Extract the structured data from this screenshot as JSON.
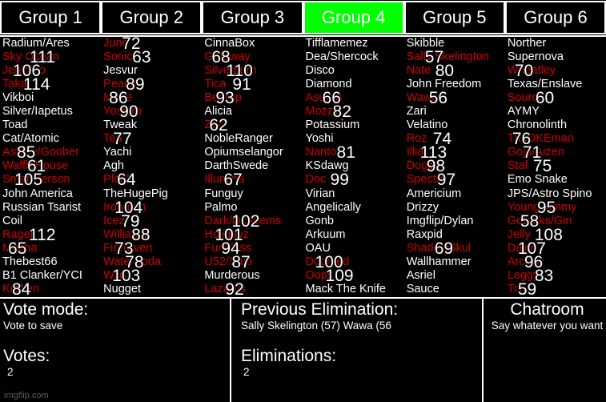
{
  "tabs": [
    {
      "label": "Group 1",
      "active": false
    },
    {
      "label": "Group 2",
      "active": false
    },
    {
      "label": "Group 3",
      "active": false
    },
    {
      "label": "Group 4",
      "active": true
    },
    {
      "label": "Group 5",
      "active": false
    },
    {
      "label": "Group 6",
      "active": false
    }
  ],
  "colors": {
    "active_tab": "#00ff00",
    "eliminated_text": "#cc0000",
    "alive_text": "#ffffff",
    "background": "#000000"
  },
  "groups": [
    {
      "name": "Group 1",
      "entries": [
        {
          "name": "Radium/Ares",
          "eliminated": false,
          "number": null
        },
        {
          "name": "Sky Ocean",
          "eliminated": true,
          "number": "111"
        },
        {
          "name": "Jehldino",
          "eliminated": true,
          "number": "106"
        },
        {
          "name": "Taka",
          "eliminated": true,
          "number": "114"
        },
        {
          "name": "Vikboi",
          "eliminated": false,
          "number": null
        },
        {
          "name": "Silver/Iapetus",
          "eliminated": false,
          "number": null
        },
        {
          "name": "Toad",
          "eliminated": false,
          "number": null
        },
        {
          "name": "Cat/Atomic",
          "eliminated": false,
          "number": null
        },
        {
          "name": "Ashley/Goober",
          "eliminated": true,
          "number": "85"
        },
        {
          "name": "WaffleHouse",
          "eliminated": true,
          "number": "61"
        },
        {
          "name": "SmartPerson",
          "eliminated": true,
          "number": "105"
        },
        {
          "name": "John America",
          "eliminated": false,
          "number": null
        },
        {
          "name": "Russian Tsarist",
          "eliminated": false,
          "number": null
        },
        {
          "name": "Coil",
          "eliminated": false,
          "number": null
        },
        {
          "name": "Rager",
          "eliminated": true,
          "number": "112"
        },
        {
          "name": "Mocha",
          "eliminated": true,
          "number": "65"
        },
        {
          "name": "Thebest66",
          "eliminated": false,
          "number": null
        },
        {
          "name": "B1 Clanker/YCI",
          "eliminated": false,
          "number": null
        },
        {
          "name": "Kraken",
          "eliminated": true,
          "number": "84"
        }
      ]
    },
    {
      "name": "Group 2",
      "entries": [
        {
          "name": "Juno",
          "eliminated": true,
          "number": "72"
        },
        {
          "name": "Sonic",
          "eliminated": true,
          "number": "63"
        },
        {
          "name": "Jesvur",
          "eliminated": false,
          "number": null
        },
        {
          "name": "Peach",
          "eliminated": true,
          "number": "89"
        },
        {
          "name": "Mane",
          "eliminated": true,
          "number": "86"
        },
        {
          "name": "Yoshiro",
          "eliminated": true,
          "number": "90"
        },
        {
          "name": "Tweak",
          "eliminated": false,
          "number": null
        },
        {
          "name": "Tea",
          "eliminated": true,
          "number": "77"
        },
        {
          "name": "Yachi",
          "eliminated": false,
          "number": null
        },
        {
          "name": "Agh",
          "eliminated": false,
          "number": null
        },
        {
          "name": "Plonk",
          "eliminated": true,
          "number": "64"
        },
        {
          "name": "TheHugePig",
          "eliminated": false,
          "number": null
        },
        {
          "name": "Ironman",
          "eliminated": true,
          "number": "104"
        },
        {
          "name": "Icez",
          "eliminated": true,
          "number": "79"
        },
        {
          "name": "William i",
          "eliminated": true,
          "number": "88"
        },
        {
          "name": "Fireraven",
          "eliminated": true,
          "number": "73"
        },
        {
          "name": "WaterSoda",
          "eliminated": true,
          "number": "78"
        },
        {
          "name": "Wild",
          "eliminated": true,
          "number": "103"
        },
        {
          "name": "Nugget",
          "eliminated": false,
          "number": null
        }
      ]
    },
    {
      "name": "Group 3",
      "entries": [
        {
          "name": "CinnaBox",
          "eliminated": false,
          "number": null
        },
        {
          "name": "Getaway",
          "eliminated": true,
          "number": "68"
        },
        {
          "name": "Silverburn",
          "eliminated": true,
          "number": "110"
        },
        {
          "name": "Tica",
          "eliminated": true,
          "number": "91"
        },
        {
          "name": "Bedrop",
          "eliminated": true,
          "number": "93"
        },
        {
          "name": "Alicia",
          "eliminated": false,
          "number": null
        },
        {
          "name": "Zac",
          "eliminated": true,
          "number": "62"
        },
        {
          "name": "NobleRanger",
          "eliminated": false,
          "number": null
        },
        {
          "name": "Opiumselangor",
          "eliminated": false,
          "number": null
        },
        {
          "name": "DarthSwede",
          "eliminated": false,
          "number": null
        },
        {
          "name": "Illumina",
          "eliminated": true,
          "number": "67"
        },
        {
          "name": "Funguy",
          "eliminated": false,
          "number": null
        },
        {
          "name": "Palmo",
          "eliminated": false,
          "number": null
        },
        {
          "name": "Dark/Dcheems",
          "eliminated": true,
          "number": "102"
        },
        {
          "name": "Holidayz",
          "eliminated": true,
          "number": "101"
        },
        {
          "name": "Fungluss",
          "eliminated": true,
          "number": "94"
        },
        {
          "name": "U52/Shib",
          "eliminated": true,
          "number": "87"
        },
        {
          "name": "Murderous",
          "eliminated": false,
          "number": null
        },
        {
          "name": "Lazarus",
          "eliminated": true,
          "number": "92"
        }
      ]
    },
    {
      "name": "Group 4",
      "entries": [
        {
          "name": "Tifflamemez",
          "eliminated": false,
          "number": null
        },
        {
          "name": "Dea/Shercock",
          "eliminated": false,
          "number": null
        },
        {
          "name": "Disco",
          "eliminated": false,
          "number": null
        },
        {
          "name": "Diamond",
          "eliminated": false,
          "number": null
        },
        {
          "name": "Asuran",
          "eliminated": true,
          "number": "66"
        },
        {
          "name": "Mozzy",
          "eliminated": true,
          "number": "82"
        },
        {
          "name": "Potassium",
          "eliminated": false,
          "number": null
        },
        {
          "name": "Yoshi",
          "eliminated": false,
          "number": null
        },
        {
          "name": "Nanto",
          "eliminated": true,
          "number": "81"
        },
        {
          "name": "KSdawg",
          "eliminated": false,
          "number": null
        },
        {
          "name": "Doc",
          "eliminated": true,
          "number": "99"
        },
        {
          "name": "Virian",
          "eliminated": false,
          "number": null
        },
        {
          "name": "Angelically",
          "eliminated": false,
          "number": null
        },
        {
          "name": "Gonb",
          "eliminated": false,
          "number": null
        },
        {
          "name": "Arkuum",
          "eliminated": false,
          "number": null
        },
        {
          "name": "OAU",
          "eliminated": false,
          "number": null
        },
        {
          "name": "Doomed",
          "eliminated": true,
          "number": "100"
        },
        {
          "name": "Oops",
          "eliminated": true,
          "number": "109"
        },
        {
          "name": "Mack The Knife",
          "eliminated": false,
          "number": null
        }
      ]
    },
    {
      "name": "Group 5",
      "entries": [
        {
          "name": "Skibble",
          "eliminated": false,
          "number": null
        },
        {
          "name": "Sally Skelington",
          "eliminated": true,
          "number": "57"
        },
        {
          "name": "Nate",
          "eliminated": true,
          "number": "80"
        },
        {
          "name": "John Freedom",
          "eliminated": false,
          "number": null
        },
        {
          "name": "Wawa",
          "eliminated": true,
          "number": "56"
        },
        {
          "name": "Zari",
          "eliminated": false,
          "number": null
        },
        {
          "name": "Velatino",
          "eliminated": false,
          "number": null
        },
        {
          "name": "Roz",
          "eliminated": true,
          "number": "74"
        },
        {
          "name": "Illia",
          "eliminated": true,
          "number": "113"
        },
        {
          "name": "Dogzil",
          "eliminated": true,
          "number": "98"
        },
        {
          "name": "Spectre",
          "eliminated": true,
          "number": "97"
        },
        {
          "name": "Americium",
          "eliminated": false,
          "number": null
        },
        {
          "name": "Drizzy",
          "eliminated": false,
          "number": null
        },
        {
          "name": "Imgflip/Dylan",
          "eliminated": false,
          "number": null
        },
        {
          "name": "Raxpid",
          "eliminated": false,
          "number": null
        },
        {
          "name": "ShadowSkul",
          "eliminated": true,
          "number": "69"
        },
        {
          "name": "Wallhammer",
          "eliminated": false,
          "number": null
        },
        {
          "name": "Asriel",
          "eliminated": false,
          "number": null
        },
        {
          "name": "Sauce",
          "eliminated": false,
          "number": null
        }
      ]
    },
    {
      "name": "Group 6",
      "entries": [
        {
          "name": "Norther",
          "eliminated": false,
          "number": null
        },
        {
          "name": "Supernova",
          "eliminated": false,
          "number": null
        },
        {
          "name": "Wheatley",
          "eliminated": true,
          "number": "70"
        },
        {
          "name": "Texas/Enslave",
          "eliminated": false,
          "number": null
        },
        {
          "name": "Source",
          "eliminated": true,
          "number": "60"
        },
        {
          "name": "AYMY",
          "eliminated": false,
          "number": null
        },
        {
          "name": "Chronolinth",
          "eliminated": false,
          "number": null
        },
        {
          "name": "TheDKEman",
          "eliminated": true,
          "number": "76"
        },
        {
          "name": "Gojo/Aizen",
          "eliminated": true,
          "number": "71"
        },
        {
          "name": "Staf",
          "eliminated": true,
          "number": "75"
        },
        {
          "name": "Emo Snake",
          "eliminated": false,
          "number": null
        },
        {
          "name": "JPS/Astro Spino",
          "eliminated": false,
          "number": null
        },
        {
          "name": "Young Jimmy",
          "eliminated": true,
          "number": "95"
        },
        {
          "name": "Gotanks/Gin",
          "eliminated": true,
          "number": "58"
        },
        {
          "name": "Jelly",
          "eliminated": true,
          "number": "108"
        },
        {
          "name": "Dawn",
          "eliminated": true,
          "number": "107"
        },
        {
          "name": "Arcrew",
          "eliminated": true,
          "number": "96"
        },
        {
          "name": "Leggy",
          "eliminated": true,
          "number": "83"
        },
        {
          "name": "Tix",
          "eliminated": true,
          "number": "59"
        }
      ]
    }
  ],
  "bottom": {
    "vote_mode_label": "Vote mode:",
    "vote_mode_value": "Vote to save",
    "votes_label": "Votes:",
    "votes_value": "2",
    "previous_elimination_label": "Previous Elimination:",
    "previous_elimination_value": "Sally Skelington (57) Wawa (56",
    "eliminations_label": "Eliminations:",
    "eliminations_value": "2",
    "chatroom_label": "Chatroom",
    "chatroom_sub": "Say whatever you want"
  },
  "watermark": "imgflip.com"
}
